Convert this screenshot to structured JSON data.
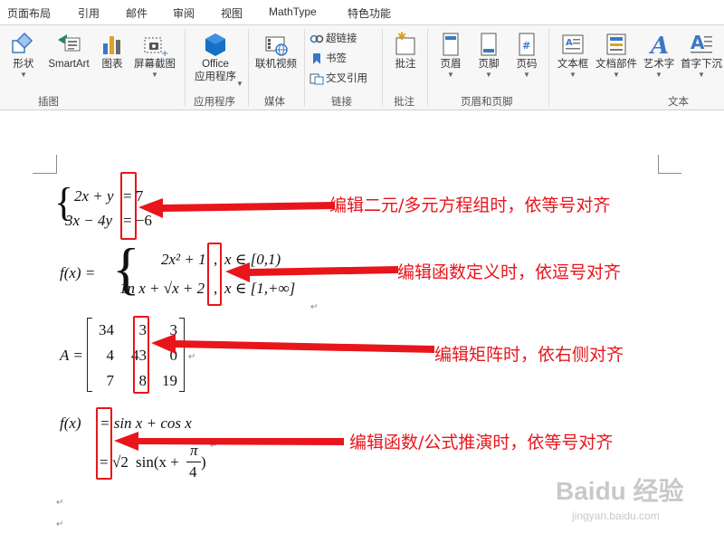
{
  "tabs": [
    "页面布局",
    "引用",
    "邮件",
    "审阅",
    "视图",
    "MathType",
    "特色功能"
  ],
  "ribbon": {
    "shapes": "形状",
    "smartart": "SmartArt",
    "chart": "图表",
    "screenshot": "屏幕截图",
    "office_apps_line1": "Office",
    "office_apps_line2": "应用程序",
    "online_video": "联机视频",
    "hyperlink": "超链接",
    "bookmark": "书签",
    "cross_reference": "交叉引用",
    "comment": "批注",
    "header": "页眉",
    "footer": "页脚",
    "page_number": "页码",
    "text_box": "文本框",
    "quick_parts": "文档部件",
    "wordart": "艺术字",
    "drop_cap": "首字下沉"
  },
  "groups": {
    "illustrations": "插图",
    "apps": "应用程序",
    "media": "媒体",
    "links": "链接",
    "comments": "批注",
    "header_footer": "页眉和页脚",
    "text": "文本"
  },
  "annotations": {
    "a1": "编辑二元/多元方程组时，依等号对齐",
    "a2": "编辑函数定义时，依逗号对齐",
    "a3": "编辑矩阵时，依右侧对齐",
    "a4": "编辑函数/公式推演时，依等号对齐"
  },
  "equations": {
    "e1_r1": "2x + y",
    "e1_r1_rhs": "= 7",
    "e1_r2": "3x − 4y",
    "e1_r2_rhs": "= −6",
    "e2_lhs": "f(x) =",
    "e2_r1": "2x² + 1",
    "e2_r1_cond": "x ∈ [0,1)",
    "e2_r2": "1n x + √x + 2",
    "e2_r2_cond": "x ∈ [1,+∞]",
    "e2_comma": ",",
    "e3_lhs": "A =",
    "matrix": [
      [
        "34",
        "3",
        "3"
      ],
      [
        "4",
        "43",
        "0"
      ],
      [
        "7",
        "8",
        "19"
      ]
    ],
    "e4_lhs": "f(x)",
    "e4_r1": "= sin x + cos x",
    "e4_r2_eq": "=",
    "e4_r2_sqrt": "√2",
    "e4_r2_sin": "sin(x +",
    "e4_r2_pi": "π",
    "e4_r2_four": "4",
    "e4_r2_close": ")"
  },
  "para_mark": "↵",
  "watermark": {
    "brand": "Baidu 经验",
    "url": "jingyan.baidu.com"
  },
  "colors": {
    "accent_red": "#e8151b",
    "ribbon_bg": "#f7f7f7"
  }
}
